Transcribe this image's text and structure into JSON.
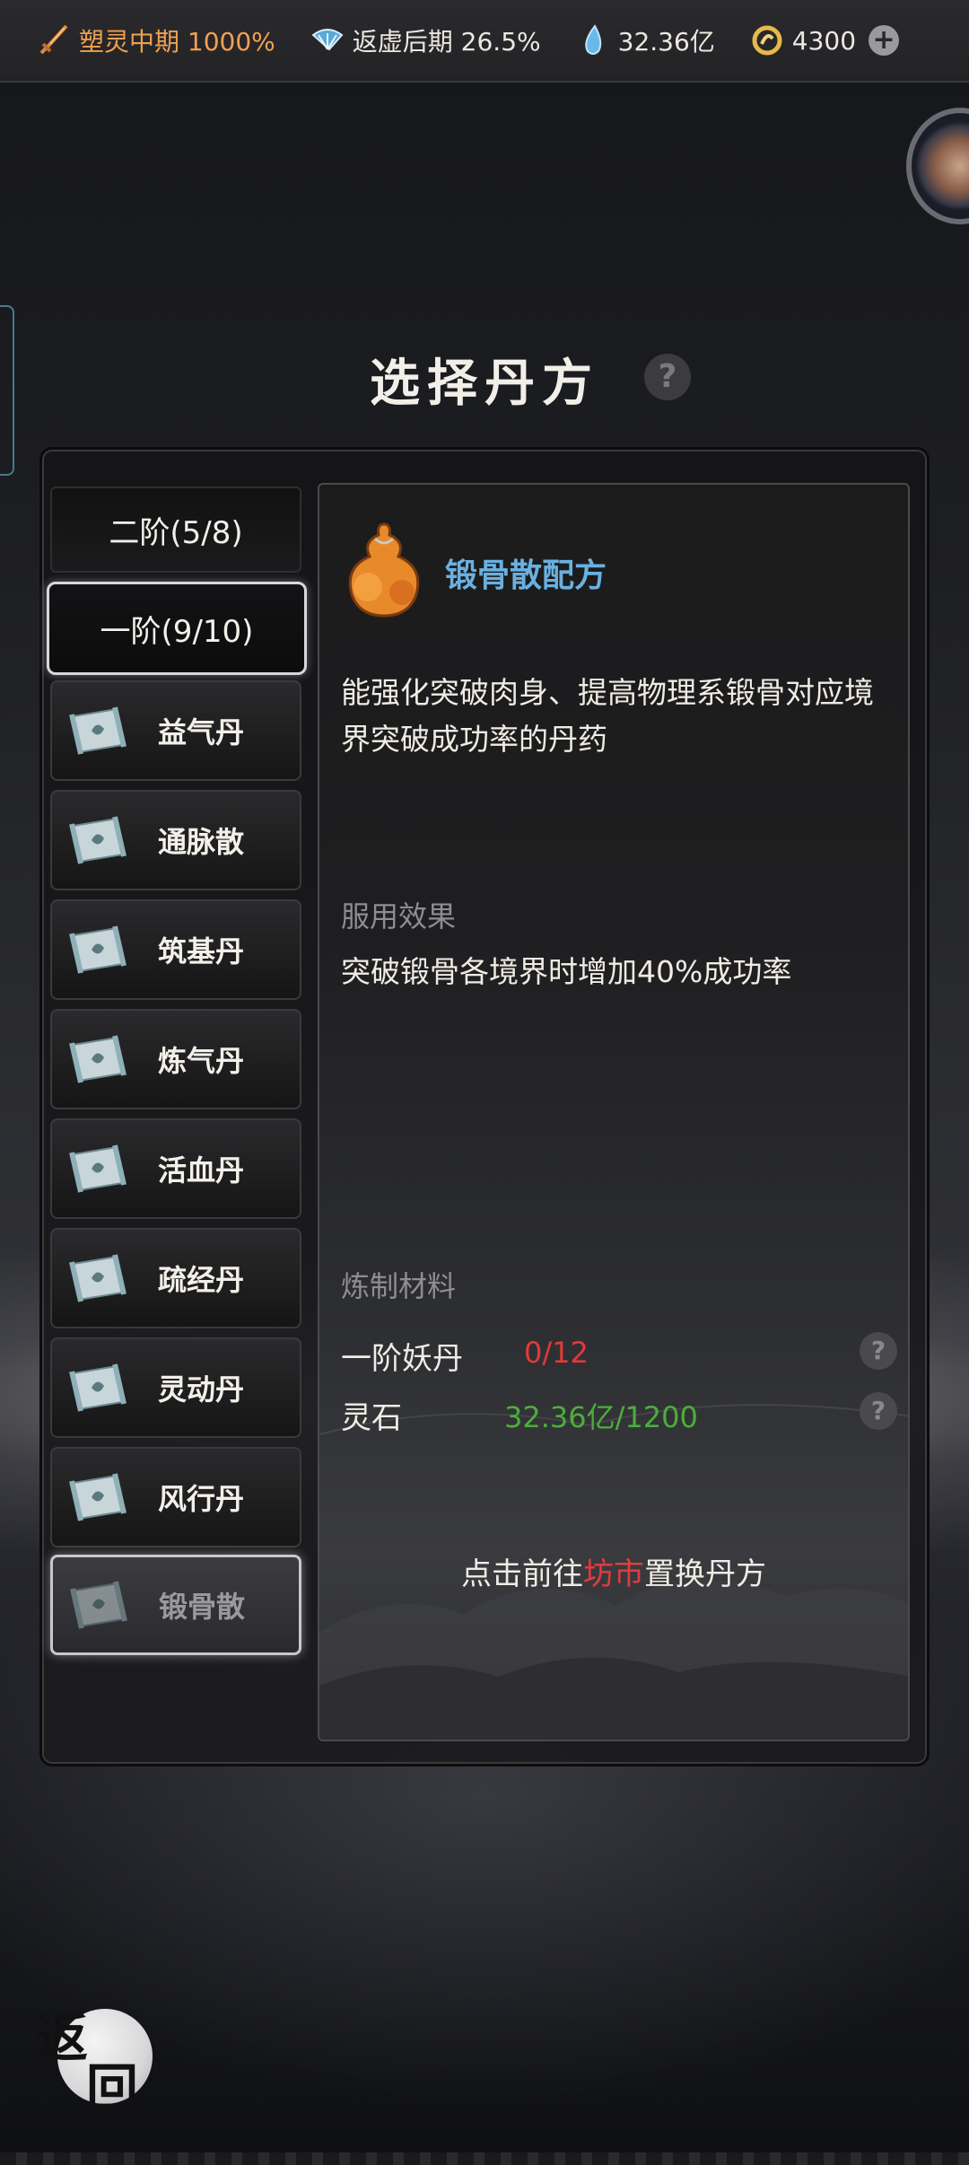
{
  "topbar": {
    "realm1": "塑灵中期 1000%",
    "realm2": "返虚后期 26.5%",
    "spirit_stones": "32.36亿",
    "coins": "4300",
    "plus": "+"
  },
  "title": "选择丹方",
  "help": "?",
  "tabs": [
    {
      "label": "二阶(5/8)"
    },
    {
      "label": "一阶(9/10)"
    }
  ],
  "recipes": [
    {
      "label": "益气丹"
    },
    {
      "label": "通脉散"
    },
    {
      "label": "筑基丹"
    },
    {
      "label": "炼气丹"
    },
    {
      "label": "活血丹"
    },
    {
      "label": "疏经丹"
    },
    {
      "label": "灵动丹"
    },
    {
      "label": "风行丹"
    },
    {
      "label": "锻骨散"
    }
  ],
  "detail": {
    "name": "锻骨散配方",
    "description": "能强化突破肉身、提高物理系锻骨对应境界突破成功率的丹药",
    "effect_heading": "服用效果",
    "effect": "突破锻骨各境界时增加40%成功率",
    "materials_heading": "炼制材料",
    "materials": [
      {
        "name": "一阶妖丹",
        "amount": "0/12",
        "color": "#e03a3a"
      },
      {
        "name": "灵石",
        "amount": "32.36亿/1200",
        "color": "#4cae3a"
      }
    ],
    "goto_prefix": "点击前往",
    "goto_link": "坊市",
    "goto_suffix": "置换丹方"
  },
  "back": {
    "char1": "返",
    "char2": "回"
  },
  "colors": {
    "accent_blue": "#6ab0e0",
    "orange": "#f0a050",
    "red": "#e03a3a",
    "green": "#4cae3a"
  },
  "icons": [
    "sword-icon",
    "fan-icon",
    "water-drop-icon",
    "coin-icon",
    "plus-icon",
    "gourd-icon",
    "scroll-icon"
  ]
}
